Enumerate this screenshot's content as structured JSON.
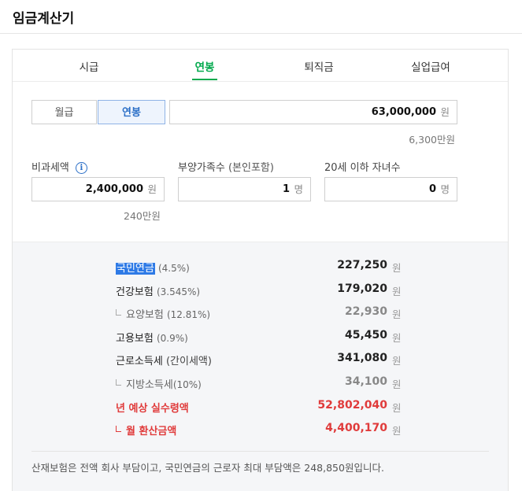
{
  "page": {
    "title": "임금계산기"
  },
  "tabs": [
    {
      "label": "시급"
    },
    {
      "label": "연봉"
    },
    {
      "label": "퇴직금"
    },
    {
      "label": "실업급여"
    }
  ],
  "active_tab": "연봉",
  "pay_type": {
    "options": [
      {
        "label": "월급"
      },
      {
        "label": "연봉"
      }
    ],
    "selected": "연봉"
  },
  "salary": {
    "value": "63,000,000",
    "unit": "원",
    "hint": "6,300만원"
  },
  "nontaxable": {
    "label": "비과세액",
    "info_icon": "info-icon",
    "value": "2,400,000",
    "unit": "원",
    "hint": "240만원"
  },
  "dependents": {
    "label": "부양가족수",
    "sub_label": "(본인포함)",
    "value": "1",
    "unit": "명"
  },
  "children": {
    "label": "20세 이하 자녀수",
    "value": "0",
    "unit": "명"
  },
  "results": [
    {
      "name": "국민연금",
      "rate": "(4.5%)",
      "amount": "227,250",
      "unit": "원"
    },
    {
      "name": "건강보험",
      "rate": "(3.545%)",
      "amount": "179,020",
      "unit": "원"
    },
    {
      "name": "요양보험",
      "rate": "(12.81%)",
      "amount": "22,930",
      "unit": "원"
    },
    {
      "name": "고용보험",
      "rate": "(0.9%)",
      "amount": "45,450",
      "unit": "원"
    },
    {
      "name": "근로소득세",
      "rate": "(간이세액)",
      "amount": "341,080",
      "unit": "원"
    },
    {
      "name": "지방소득세",
      "rate": "(10%)",
      "amount": "34,100",
      "unit": "원"
    },
    {
      "name": "년 예상 실수령액",
      "rate": "",
      "amount": "52,802,040",
      "unit": "원"
    },
    {
      "name": "월 환산금액",
      "rate": "",
      "amount": "4,400,170",
      "unit": "원"
    }
  ],
  "note": "산재보험은 전액 회사 부담이고, 국민연금의 근로자 최대 부담액은 248,850원입니다.",
  "colors": {
    "accent_green": "#03a94d",
    "accent_blue": "#2b6fc7",
    "highlight": "#e03b3b"
  }
}
